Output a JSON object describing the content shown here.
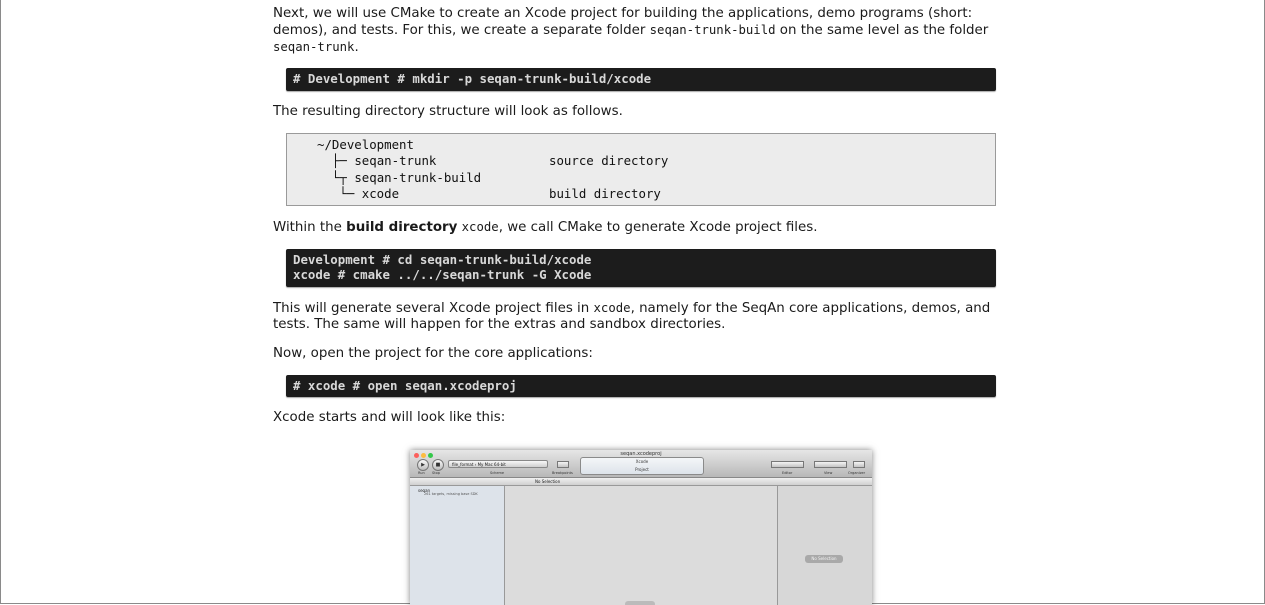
{
  "intro": {
    "part1": "Next, we will use CMake to create an Xcode project for building the applications, demo programs (short: demos), and tests. For this, we create a separate folder ",
    "code1": "seqan-trunk-build",
    "part2": " on the same level as the folder ",
    "code2": "seqan-trunk",
    "part3": "."
  },
  "cmd1": [
    "# Development # mkdir -p seqan-trunk-build/xcode"
  ],
  "tree_intro": "The resulting directory structure will look as follows.",
  "tree": {
    "root": "~/Development",
    "rows": [
      {
        "prefix": "  ├─ ",
        "name": "seqan-trunk",
        "desc": "source directory"
      },
      {
        "prefix": "  └┬ ",
        "name": "seqan-trunk-build",
        "desc": ""
      },
      {
        "prefix": "   └─ ",
        "name": "xcode",
        "desc": "build directory"
      }
    ]
  },
  "within": {
    "part1": "Within the ",
    "bold": "build directory",
    "part2": " ",
    "code": "xcode",
    "part3": ", we call CMake to generate Xcode project files."
  },
  "cmd2": [
    "Development # cd seqan-trunk-build/xcode",
    "xcode # cmake ../../seqan-trunk -G Xcode"
  ],
  "generate": {
    "part1": "This will generate several Xcode project files in ",
    "code": "xcode",
    "part2": ", namely for the SeqAn core applications, demos, and tests. The same will happen for the extras and sandbox directories."
  },
  "open_intro": "Now, open the project for the core applications:",
  "cmd3": [
    "# xcode # open seqan.xcodeproj"
  ],
  "xcode_intro": "Xcode starts and will look like this:",
  "xcode_window": {
    "title": "seqan.xcodeproj",
    "scheme": "file_format › My Mac 64-bit",
    "activity_title": "Xcode",
    "activity_sub": "Project",
    "toolbar_labels": [
      "Run",
      "Stop",
      "Scheme",
      "Breakpoints",
      "Editor",
      "View",
      "Organizer"
    ],
    "nav_title": "No Selection",
    "project_name": "seqan",
    "project_sub": "261 targets, missing base SDK",
    "inspector_text": "No Selection",
    "colors": {
      "close": "#fc605c",
      "minimize": "#fdbc40",
      "zoom": "#34c84a"
    }
  }
}
